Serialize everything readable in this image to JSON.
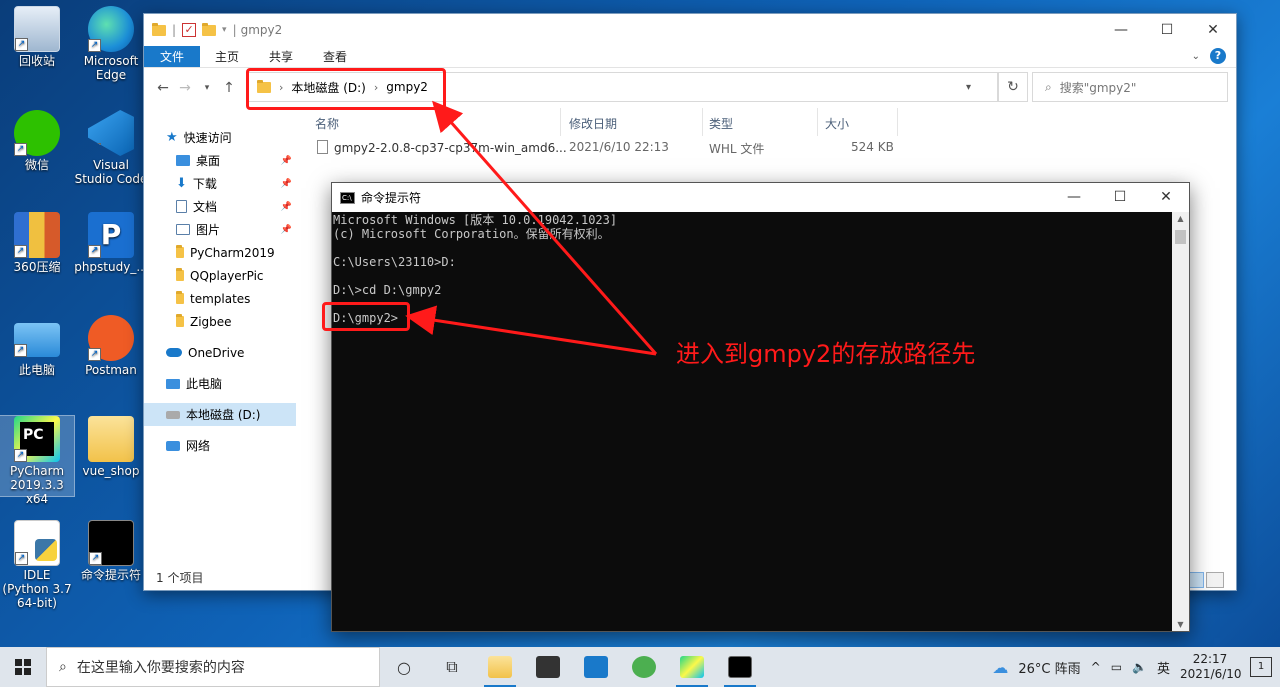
{
  "desktop": {
    "icons": [
      {
        "label": "回收站"
      },
      {
        "label": "Microsoft Edge"
      },
      {
        "label": "微信"
      },
      {
        "label": "Visual Studio Code"
      },
      {
        "label": "360压缩"
      },
      {
        "label": "phpstudy_..."
      },
      {
        "label": "此电脑"
      },
      {
        "label": "Postman"
      },
      {
        "label": "PyCharm 2019.3.3 x64"
      },
      {
        "label": "vue_shop"
      },
      {
        "label": "IDLE (Python 3.7 64-bit)"
      },
      {
        "label": "命令提示符"
      }
    ]
  },
  "explorer": {
    "title": "gmpy2",
    "ribbon_tabs": [
      "文件",
      "主页",
      "共享",
      "查看"
    ],
    "address": {
      "drive": "本地磁盘 (D:)",
      "folder": "gmpy2"
    },
    "search_placeholder": "搜索\"gmpy2\"",
    "nav": {
      "quick_access": "快速访问",
      "items": [
        "桌面",
        "下载",
        "文档",
        "图片",
        "PyCharm2019",
        "QQplayerPic",
        "templates",
        "Zigbee"
      ],
      "onedrive": "OneDrive",
      "this_pc": "此电脑",
      "local_disk": "本地磁盘 (D:)",
      "network": "网络"
    },
    "columns": [
      "名称",
      "修改日期",
      "类型",
      "大小"
    ],
    "files": [
      {
        "name": "gmpy2-2.0.8-cp37-cp37m-win_amd6...",
        "modified": "2021/6/10 22:13",
        "type": "WHL 文件",
        "size": "524 KB"
      }
    ],
    "status": "1 个项目"
  },
  "cmd": {
    "title": "命令提示符",
    "lines": [
      "Microsoft Windows [版本 10.0.19042.1023]",
      "(c) Microsoft Corporation。保留所有权利。",
      "",
      "C:\\Users\\23110>D:",
      "",
      "D:\\>cd D:\\gmpy2",
      "",
      "D:\\gmpy2>"
    ]
  },
  "annotation": "进入到gmpy2的存放路径先",
  "taskbar": {
    "search_placeholder": "在这里输入你要搜索的内容",
    "weather": "26°C 阵雨",
    "ime": "英",
    "time": "22:17",
    "date": "2021/6/10",
    "notif_count": "1"
  },
  "colors": {
    "accent": "#1979ca",
    "annotation": "#ff1a1a",
    "console_bg": "#0c0c0c"
  }
}
